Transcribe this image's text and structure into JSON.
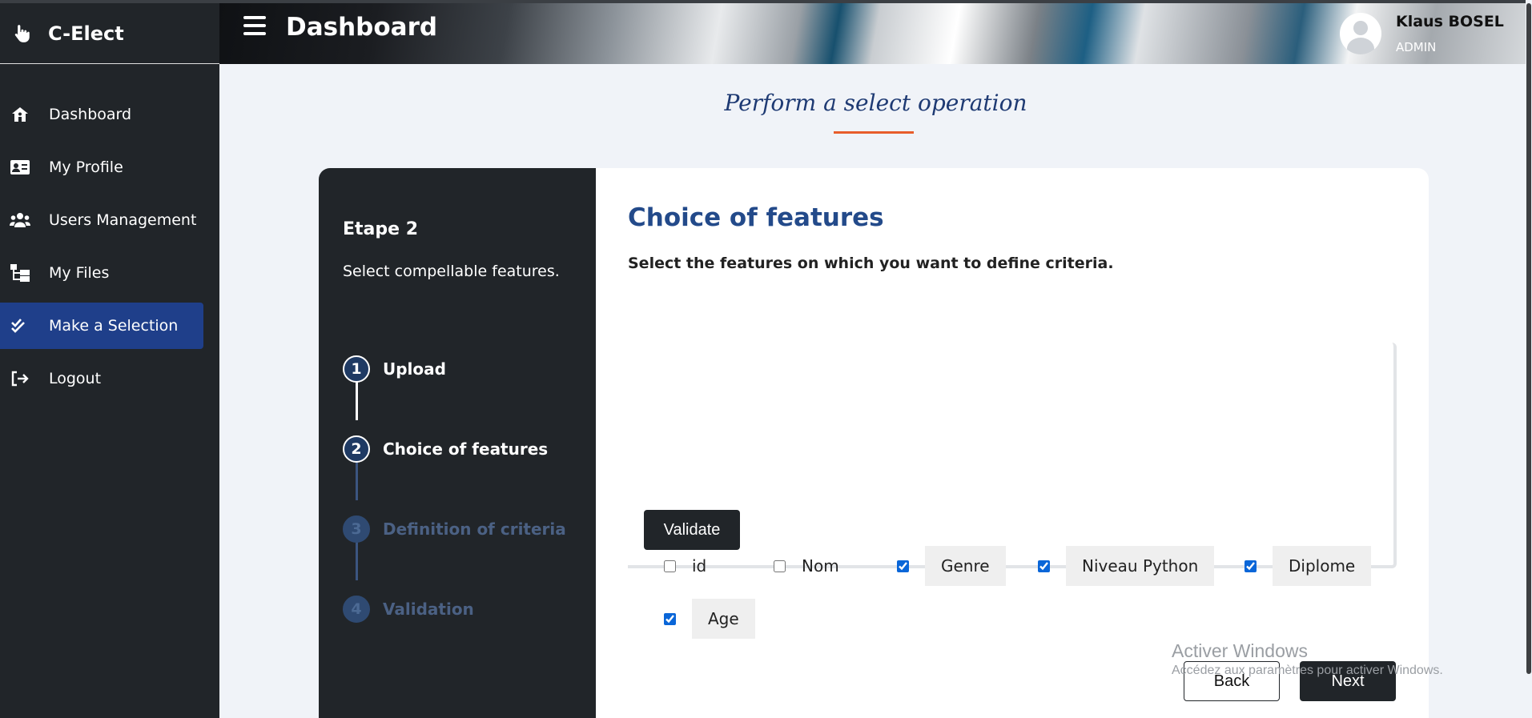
{
  "brand": {
    "name": "C-Elect",
    "logo_icon": "pointing-hand-icon"
  },
  "sidebar": {
    "items": [
      {
        "label": "Dashboard",
        "icon": "home-icon",
        "active": false
      },
      {
        "label": "My Profile",
        "icon": "id-card-icon",
        "active": false
      },
      {
        "label": "Users Management",
        "icon": "users-icon",
        "active": false
      },
      {
        "label": "My Files",
        "icon": "folder-tree-icon",
        "active": false
      },
      {
        "label": "Make a Selection",
        "icon": "double-check-icon",
        "active": true
      },
      {
        "label": "Logout",
        "icon": "logout-icon",
        "active": false
      }
    ]
  },
  "header": {
    "title": "Dashboard",
    "menu_icon": "hamburger-icon"
  },
  "user": {
    "name": "Klaus BOSEL",
    "role": "ADMIN",
    "avatar_icon": "user-avatar-icon"
  },
  "page": {
    "title": "Perform a select operation",
    "accent_color": "#e85d2b"
  },
  "stepper": {
    "etape": "Etape 2",
    "description": "Select compellable features.",
    "steps": [
      {
        "num": "1",
        "label": "Upload",
        "state": "done"
      },
      {
        "num": "2",
        "label": "Choice of features",
        "state": "current"
      },
      {
        "num": "3",
        "label": "Definition of criteria",
        "state": "inactive"
      },
      {
        "num": "4",
        "label": "Validation",
        "state": "inactive"
      }
    ]
  },
  "content": {
    "heading": "Choice of features",
    "subheading": "Select the features on which you want to define criteria.",
    "features": [
      {
        "label": "id",
        "checked": false
      },
      {
        "label": "Nom",
        "checked": false
      },
      {
        "label": "Genre",
        "checked": true
      },
      {
        "label": "Niveau Python",
        "checked": true
      },
      {
        "label": "Diplome",
        "checked": true
      },
      {
        "label": "Age",
        "checked": true
      }
    ],
    "validate_label": "Validate"
  },
  "footer": {
    "back_label": "Back",
    "next_label": "Next"
  },
  "watermark": {
    "line1": "Activer Windows",
    "line2": "Accédez aux paramètres pour activer Windows."
  },
  "colors": {
    "sidebar_bg": "#212529",
    "active_nav": "#1f3f8a",
    "heading_blue": "#234a8a"
  }
}
